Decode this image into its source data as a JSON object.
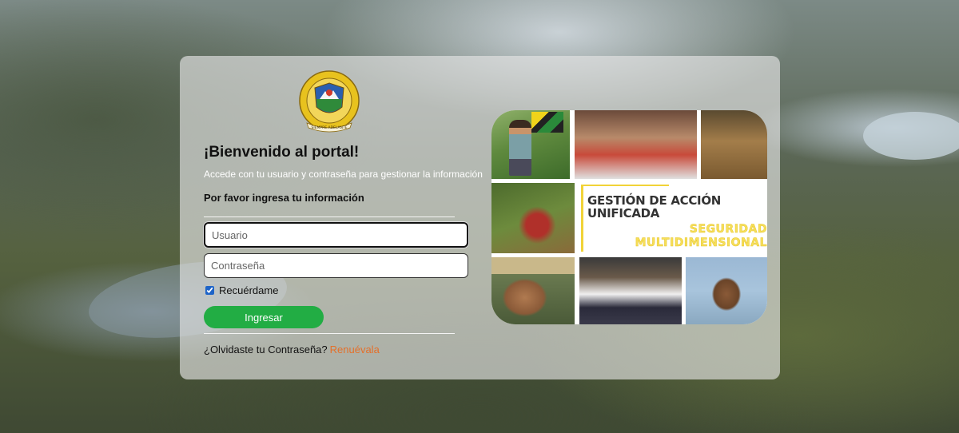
{
  "welcome": {
    "title": "¡Bienvenido al portal!",
    "subtitle": "Accede con tu usuario y contraseña para gestionar la información",
    "info_title": "Por favor ingresa tu información"
  },
  "form": {
    "username_placeholder": "Usuario",
    "password_placeholder": "Contraseña",
    "remember_label": "Recuérdame",
    "remember_checked": true,
    "login_label": "Ingresar",
    "forgot_text": "¿Olvidaste tu Contraseña?",
    "forgot_link": "Renuévala"
  },
  "logo": {
    "ring_text": "DEPARTAMENTO DE SANTANDER",
    "ribbon_text": "SIEMPRE ADELANTE"
  },
  "banner": {
    "line1": "GESTIÓN DE ACCIÓN",
    "line2": "UNIFICADA",
    "line3": "SEGURIDAD",
    "line4": "MULTIDIMENSIONAL"
  },
  "colors": {
    "login_button": "#22ad44",
    "forgot_link": "#e4702a",
    "banner_accent": "#f6df5a"
  }
}
